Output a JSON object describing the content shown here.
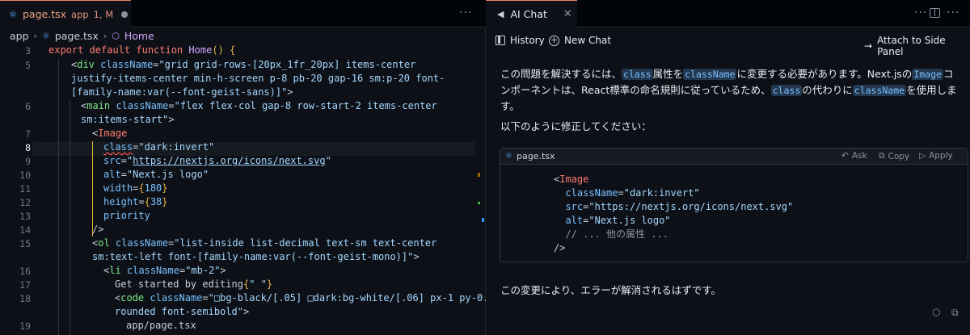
{
  "editor": {
    "tab": {
      "filename": "page.tsx",
      "folder": "app",
      "status": "1, M"
    },
    "more": "···",
    "breadcrumb": [
      "app",
      "page.tsx",
      "Home"
    ],
    "line_numbers": [
      "3",
      "5",
      "",
      "",
      "6",
      "",
      "7",
      "8",
      "9",
      "10",
      "11",
      "12",
      "13",
      "14",
      "15",
      "",
      "16",
      "17",
      "18",
      "",
      "19"
    ],
    "active_line": "8"
  },
  "chat": {
    "tab_label": "AI Chat",
    "close": "✕",
    "more": "···",
    "toolbar": {
      "history": "History",
      "new_chat": "New Chat",
      "attach": "Attach to Side Panel"
    },
    "message": {
      "p1_a": "この問題を解決するには、",
      "p1_code1": "class",
      "p1_b": "属性を",
      "p1_code2": "className",
      "p1_c": "に変更する必要があります。Next.jsの",
      "p1_code3": "Image",
      "p1_d": "コンポーネントは、React標準の命名規則に従っているため、",
      "p1_code4": "class",
      "p1_e": "の代わりに",
      "p1_code5": "className",
      "p1_f": "を使用します。",
      "p2": "以下のように修正してください：",
      "p3": "この変更により、エラーが解消されるはずです。"
    },
    "code_block": {
      "filename": "page.tsx",
      "ask": "Ask",
      "copy": "Copy",
      "apply": "Apply"
    }
  }
}
